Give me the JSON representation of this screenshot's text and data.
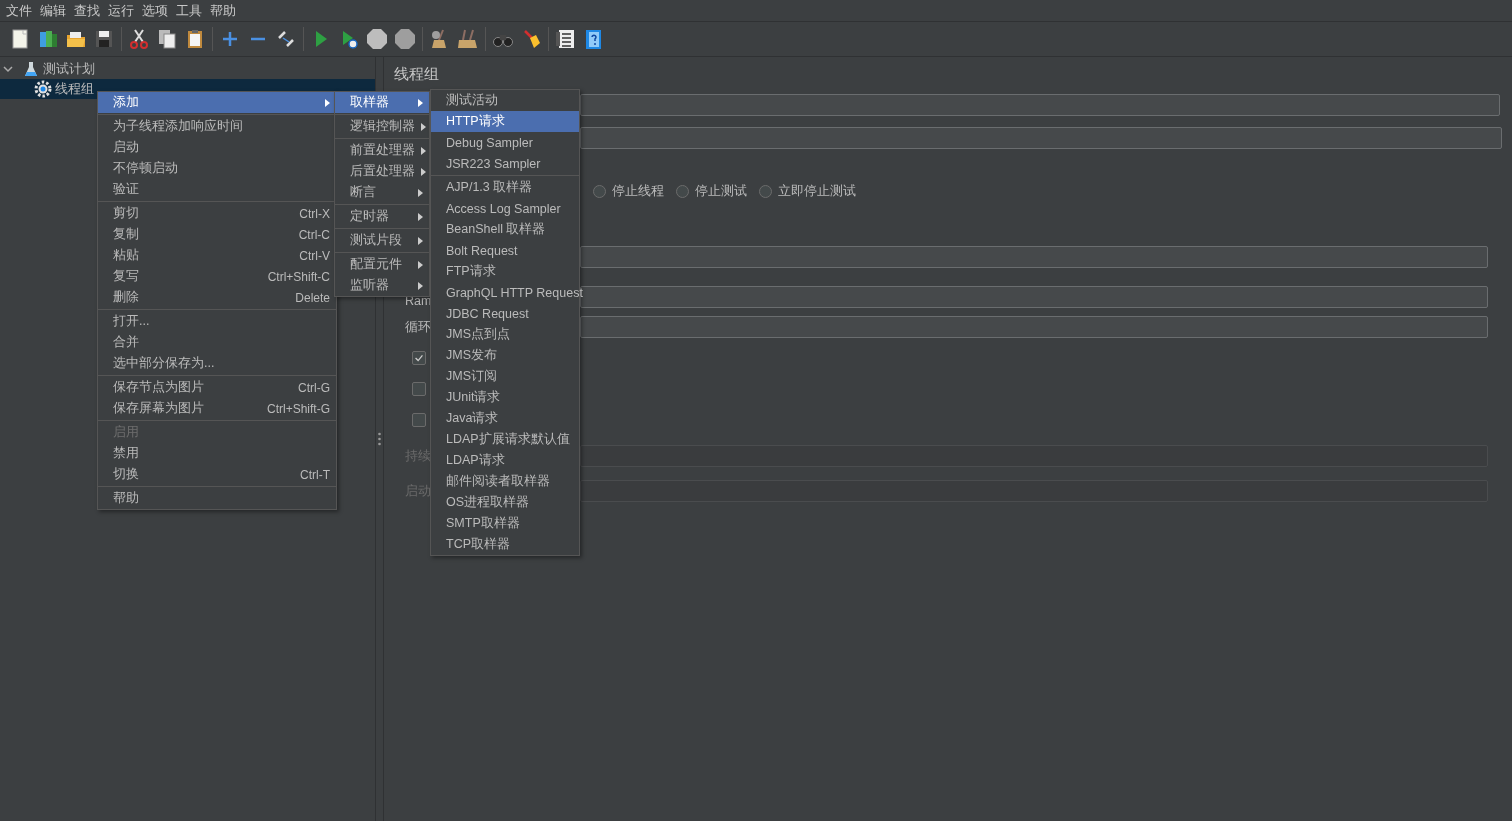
{
  "menu_bar": [
    "文件",
    "编辑",
    "查找",
    "运行",
    "选项",
    "工具",
    "帮助"
  ],
  "tree": [
    {
      "label": "测试计划",
      "expanded": true,
      "selected": false,
      "children": [
        {
          "label": "线程组",
          "selected": true
        }
      ]
    }
  ],
  "panel": {
    "title": "线程组",
    "rows": [
      {
        "kind": "field",
        "disabled": false
      },
      {
        "kind": "field",
        "disabled": false
      },
      {
        "kind": "radios",
        "options": [
          {
            "label": "停止线程",
            "selected": false
          },
          {
            "label": "停止测试",
            "selected": false
          },
          {
            "label": "立即停止测试",
            "selected": false
          }
        ]
      },
      {
        "kind": "field",
        "disabled": false
      },
      {
        "kind": "field",
        "label": "Ram",
        "disabled": false
      },
      {
        "kind": "field",
        "label": "循环",
        "disabled": false
      },
      {
        "kind": "checkbox",
        "checked": true
      },
      {
        "kind": "checkbox",
        "checked": false
      },
      {
        "kind": "checkbox",
        "checked": false
      },
      {
        "kind": "field",
        "label": "持续",
        "disabled": true
      },
      {
        "kind": "field",
        "label": "启动",
        "disabled": true
      }
    ]
  },
  "context_menu": {
    "groups": [
      [
        {
          "label": "添加",
          "submenu": true,
          "selected": true,
          "disabled": false
        }
      ],
      [
        {
          "label": "为子线程添加响应时间",
          "submenu": false,
          "selected": false,
          "disabled": false
        },
        {
          "label": "启动",
          "submenu": false,
          "selected": false,
          "disabled": false
        },
        {
          "label": "不停顿启动",
          "submenu": false,
          "selected": false,
          "disabled": false
        },
        {
          "label": "验证",
          "submenu": false,
          "selected": false,
          "disabled": false
        }
      ],
      [
        {
          "label": "剪切",
          "shortcut": "Ctrl-X",
          "submenu": false,
          "selected": false,
          "disabled": false
        },
        {
          "label": "复制",
          "shortcut": "Ctrl-C",
          "submenu": false,
          "selected": false,
          "disabled": false
        },
        {
          "label": "粘贴",
          "shortcut": "Ctrl-V",
          "submenu": false,
          "selected": false,
          "disabled": false
        },
        {
          "label": "复写",
          "shortcut": "Ctrl+Shift-C",
          "submenu": false,
          "selected": false,
          "disabled": false
        },
        {
          "label": "删除",
          "shortcut": "Delete",
          "submenu": false,
          "selected": false,
          "disabled": false
        }
      ],
      [
        {
          "label": "打开...",
          "submenu": false,
          "selected": false,
          "disabled": false
        },
        {
          "label": "合并",
          "submenu": false,
          "selected": false,
          "disabled": false
        },
        {
          "label": "选中部分保存为...",
          "submenu": false,
          "selected": false,
          "disabled": false
        }
      ],
      [
        {
          "label": "保存节点为图片",
          "shortcut": "Ctrl-G",
          "submenu": false,
          "selected": false,
          "disabled": false
        },
        {
          "label": "保存屏幕为图片",
          "shortcut": "Ctrl+Shift-G",
          "submenu": false,
          "selected": false,
          "disabled": false
        }
      ],
      [
        {
          "label": "启用",
          "submenu": false,
          "selected": false,
          "disabled": true
        },
        {
          "label": "禁用",
          "submenu": false,
          "selected": false,
          "disabled": false
        },
        {
          "label": "切换",
          "shortcut": "Ctrl-T",
          "submenu": false,
          "selected": false,
          "disabled": false
        }
      ],
      [
        {
          "label": "帮助",
          "submenu": false,
          "selected": false,
          "disabled": false
        }
      ]
    ]
  },
  "add_submenu": {
    "groups": [
      [
        {
          "label": "取样器",
          "submenu": true,
          "selected": true,
          "disabled": false
        }
      ],
      [
        {
          "label": "逻辑控制器",
          "submenu": true,
          "selected": false,
          "disabled": false
        }
      ],
      [
        {
          "label": "前置处理器",
          "submenu": true,
          "selected": false,
          "disabled": false
        },
        {
          "label": "后置处理器",
          "submenu": true,
          "selected": false,
          "disabled": false
        },
        {
          "label": "断言",
          "submenu": true,
          "selected": false,
          "disabled": false
        }
      ],
      [
        {
          "label": "定时器",
          "submenu": true,
          "selected": false,
          "disabled": false
        }
      ],
      [
        {
          "label": "测试片段",
          "submenu": true,
          "selected": false,
          "disabled": false
        }
      ],
      [
        {
          "label": "配置元件",
          "submenu": true,
          "selected": false,
          "disabled": false
        },
        {
          "label": "监听器",
          "submenu": true,
          "selected": false,
          "disabled": false
        }
      ]
    ]
  },
  "sampler_submenu": {
    "groups": [
      [
        {
          "label": "测试活动",
          "submenu": false,
          "selected": false,
          "disabled": false
        },
        {
          "label": "HTTP请求",
          "submenu": false,
          "selected": true,
          "disabled": false
        },
        {
          "label": "Debug Sampler",
          "submenu": false,
          "selected": false,
          "disabled": false
        },
        {
          "label": "JSR223 Sampler",
          "submenu": false,
          "selected": false,
          "disabled": false
        }
      ],
      [
        {
          "label": "AJP/1.3 取样器",
          "submenu": false,
          "selected": false,
          "disabled": false
        },
        {
          "label": "Access Log Sampler",
          "submenu": false,
          "selected": false,
          "disabled": false
        },
        {
          "label": "BeanShell 取样器",
          "submenu": false,
          "selected": false,
          "disabled": false
        },
        {
          "label": "Bolt Request",
          "submenu": false,
          "selected": false,
          "disabled": false
        },
        {
          "label": "FTP请求",
          "submenu": false,
          "selected": false,
          "disabled": false
        },
        {
          "label": "GraphQL HTTP Request",
          "submenu": false,
          "selected": false,
          "disabled": false
        },
        {
          "label": "JDBC Request",
          "submenu": false,
          "selected": false,
          "disabled": false
        },
        {
          "label": "JMS点到点",
          "submenu": false,
          "selected": false,
          "disabled": false
        },
        {
          "label": "JMS发布",
          "submenu": false,
          "selected": false,
          "disabled": false
        },
        {
          "label": "JMS订阅",
          "submenu": false,
          "selected": false,
          "disabled": false
        },
        {
          "label": "JUnit请求",
          "submenu": false,
          "selected": false,
          "disabled": false
        },
        {
          "label": "Java请求",
          "submenu": false,
          "selected": false,
          "disabled": false
        },
        {
          "label": "LDAP扩展请求默认值",
          "submenu": false,
          "selected": false,
          "disabled": false
        },
        {
          "label": "LDAP请求",
          "submenu": false,
          "selected": false,
          "disabled": false
        },
        {
          "label": "邮件阅读者取样器",
          "submenu": false,
          "selected": false,
          "disabled": false
        },
        {
          "label": "OS进程取样器",
          "submenu": false,
          "selected": false,
          "disabled": false
        },
        {
          "label": "SMTP取样器",
          "submenu": false,
          "selected": false,
          "disabled": false
        },
        {
          "label": "TCP取样器",
          "submenu": false,
          "selected": false,
          "disabled": false
        }
      ]
    ]
  }
}
